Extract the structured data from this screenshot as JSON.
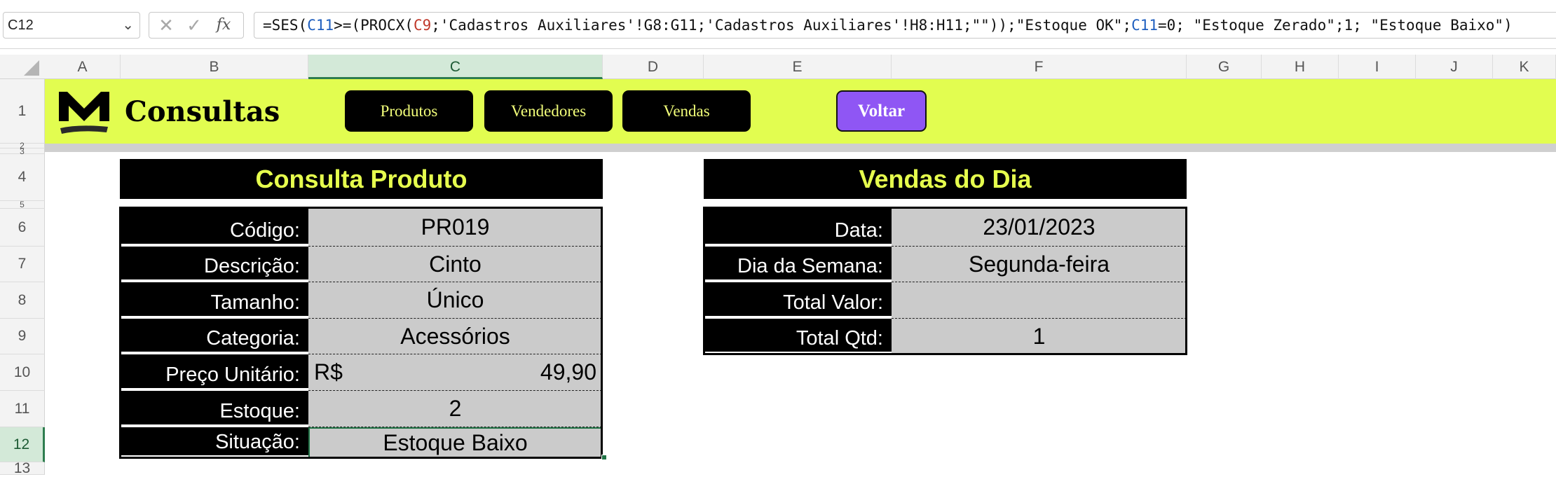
{
  "formula_bar": {
    "name_box": "C12",
    "cancel_glyph": "✕",
    "enter_glyph": "✓",
    "fx_glyph": "fx",
    "formula_parts": [
      {
        "t": "=SES(",
        "c": ""
      },
      {
        "t": "C11",
        "c": "blue"
      },
      {
        "t": ">=(PROCX(",
        "c": ""
      },
      {
        "t": "C9",
        "c": "red"
      },
      {
        "t": ";'Cadastros Auxiliares'!G8:G11;'Cadastros Auxiliares'!H8:H11;\"\"));\"Estoque OK\";",
        "c": ""
      },
      {
        "t": "C11",
        "c": "blue"
      },
      {
        "t": "=0; \"Estoque Zerado\";1; \"Estoque Baixo\")",
        "c": ""
      }
    ]
  },
  "columns": [
    "A",
    "B",
    "C",
    "D",
    "E",
    "F",
    "G",
    "H",
    "I",
    "J",
    "K"
  ],
  "selected_column": "C",
  "rows": [
    "1",
    "2",
    "3",
    "4",
    "5",
    "6",
    "7",
    "8",
    "9",
    "10",
    "11",
    "12",
    "13"
  ],
  "selected_row": "12",
  "banner": {
    "title": "Consultas",
    "buttons": [
      "Produtos",
      "Vendedores",
      "Vendas"
    ],
    "back_button": "Voltar",
    "logo": "m-logo-icon"
  },
  "produto": {
    "title": "Consulta Produto",
    "fields": [
      {
        "label": "Código:",
        "value": "PR019"
      },
      {
        "label": "Descrição:",
        "value": "Cinto"
      },
      {
        "label": "Tamanho:",
        "value": "Único"
      },
      {
        "label": "Categoria:",
        "value": "Acessórios"
      },
      {
        "label": "Preço Unitário:",
        "currency": "R$",
        "value": "49,90"
      },
      {
        "label": "Estoque:",
        "value": "2"
      },
      {
        "label": "Situação:",
        "value": "Estoque Baixo"
      }
    ]
  },
  "vendas": {
    "title": "Vendas do Dia",
    "fields": [
      {
        "label": "Data:",
        "value": "23/01/2023"
      },
      {
        "label": "Dia da Semana:",
        "value": "Segunda-feira"
      },
      {
        "label": "Total Valor:",
        "value": ""
      },
      {
        "label": "Total Qtd:",
        "value": "1"
      }
    ]
  },
  "colors": {
    "banner": "#e2fd50",
    "title_text": "#e6ff4d",
    "back_button": "#8f56f4",
    "selection": "#217346"
  }
}
